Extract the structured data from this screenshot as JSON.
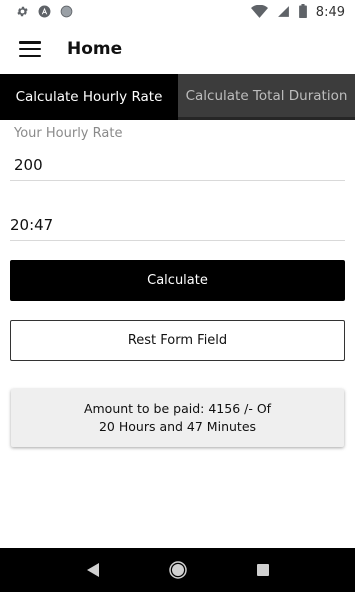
{
  "status_bar": {
    "time": "8:49",
    "icons": [
      "settings-icon",
      "angular-icon",
      "circle-icon",
      "wifi-icon",
      "signal-icon",
      "battery-icon"
    ]
  },
  "app_bar": {
    "menu_icon": "hamburger-menu-icon",
    "title": "Home"
  },
  "tabs": [
    {
      "label": "Calculate Hourly Rate",
      "active": true
    },
    {
      "label": "Calculate Total Duration",
      "active": false
    }
  ],
  "form": {
    "hourly_rate_label": "Your Hourly Rate",
    "hourly_rate_value": "200",
    "duration_value": "20:47"
  },
  "buttons": {
    "calculate": "Calculate",
    "reset": "Rest Form Field"
  },
  "result": {
    "line1": "Amount to be paid: 4156 /- Of",
    "line2": "20 Hours and 47 Minutes"
  },
  "nav_bar": {
    "icons": [
      "back-icon",
      "home-icon",
      "recents-icon"
    ]
  },
  "colors": {
    "primary": "#000000",
    "tab_inactive": "#3c3c3c",
    "result_bg": "#efefef"
  }
}
